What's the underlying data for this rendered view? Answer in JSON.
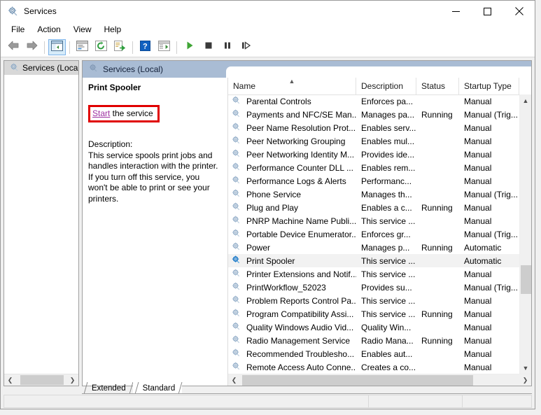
{
  "window": {
    "title": "Services",
    "icon": "services-gear-icon",
    "controls": {
      "minimize": "minimize-icon",
      "maximize": "maximize-icon",
      "close": "close-icon"
    }
  },
  "menubar": {
    "items": [
      {
        "label": "File",
        "name": "menu-file"
      },
      {
        "label": "Action",
        "name": "menu-action"
      },
      {
        "label": "View",
        "name": "menu-view"
      },
      {
        "label": "Help",
        "name": "menu-help"
      }
    ]
  },
  "toolbar": {
    "buttons": [
      {
        "name": "back-button",
        "icon": "back-arrow-icon"
      },
      {
        "name": "forward-button",
        "icon": "forward-arrow-icon"
      },
      {
        "name": "show-hide-tree-button",
        "icon": "show-tree-icon"
      },
      {
        "name": "properties-button",
        "icon": "properties-icon"
      },
      {
        "name": "refresh-button",
        "icon": "refresh-icon"
      },
      {
        "name": "export-list-button",
        "icon": "export-list-icon"
      },
      {
        "name": "help-button",
        "icon": "help-question-icon"
      },
      {
        "name": "show-action-pane-button",
        "icon": "action-pane-icon"
      },
      {
        "name": "start-service-button",
        "icon": "play-icon"
      },
      {
        "name": "stop-service-button",
        "icon": "stop-icon"
      },
      {
        "name": "pause-service-button",
        "icon": "pause-icon"
      },
      {
        "name": "restart-service-button",
        "icon": "restart-icon"
      }
    ]
  },
  "tree": {
    "root_label": "Services (Local",
    "root_icon": "services-gear-icon"
  },
  "content_header": {
    "label": "Services (Local)",
    "icon": "services-gear-icon"
  },
  "detail": {
    "service_name": "Print Spooler",
    "action_link": "Start",
    "action_suffix": " the service",
    "description_label": "Description:",
    "description_text": "This service spools print jobs and handles interaction with the printer. If you turn off this service, you won't be able to print or see your printers."
  },
  "list": {
    "columns": [
      {
        "label": "Name",
        "name": "column-header-name",
        "sort": "ascending"
      },
      {
        "label": "Description",
        "name": "column-header-description"
      },
      {
        "label": "Status",
        "name": "column-header-status"
      },
      {
        "label": "Startup Type",
        "name": "column-header-startup-type"
      }
    ],
    "rows": [
      {
        "name": "Parental Controls",
        "description": "Enforces pa...",
        "status": "",
        "startup": "Manual",
        "selected": false
      },
      {
        "name": "Payments and NFC/SE Man...",
        "description": "Manages pa...",
        "status": "Running",
        "startup": "Manual (Trig...",
        "selected": false
      },
      {
        "name": "Peer Name Resolution Prot...",
        "description": "Enables serv...",
        "status": "",
        "startup": "Manual",
        "selected": false
      },
      {
        "name": "Peer Networking Grouping",
        "description": "Enables mul...",
        "status": "",
        "startup": "Manual",
        "selected": false
      },
      {
        "name": "Peer Networking Identity M...",
        "description": "Provides ide...",
        "status": "",
        "startup": "Manual",
        "selected": false
      },
      {
        "name": "Performance Counter DLL ...",
        "description": "Enables rem...",
        "status": "",
        "startup": "Manual",
        "selected": false
      },
      {
        "name": "Performance Logs & Alerts",
        "description": "Performanc...",
        "status": "",
        "startup": "Manual",
        "selected": false
      },
      {
        "name": "Phone Service",
        "description": "Manages th...",
        "status": "",
        "startup": "Manual (Trig...",
        "selected": false
      },
      {
        "name": "Plug and Play",
        "description": "Enables a c...",
        "status": "Running",
        "startup": "Manual",
        "selected": false
      },
      {
        "name": "PNRP Machine Name Publi...",
        "description": "This service ...",
        "status": "",
        "startup": "Manual",
        "selected": false
      },
      {
        "name": "Portable Device Enumerator...",
        "description": "Enforces gr...",
        "status": "",
        "startup": "Manual (Trig...",
        "selected": false
      },
      {
        "name": "Power",
        "description": "Manages p...",
        "status": "Running",
        "startup": "Automatic",
        "selected": false
      },
      {
        "name": "Print Spooler",
        "description": "This service ...",
        "status": "",
        "startup": "Automatic",
        "selected": true
      },
      {
        "name": "Printer Extensions and Notif...",
        "description": "This service ...",
        "status": "",
        "startup": "Manual",
        "selected": false
      },
      {
        "name": "PrintWorkflow_52023",
        "description": "Provides su...",
        "status": "",
        "startup": "Manual (Trig...",
        "selected": false
      },
      {
        "name": "Problem Reports Control Pa...",
        "description": "This service ...",
        "status": "",
        "startup": "Manual",
        "selected": false
      },
      {
        "name": "Program Compatibility Assi...",
        "description": "This service ...",
        "status": "Running",
        "startup": "Manual",
        "selected": false
      },
      {
        "name": "Quality Windows Audio Vid...",
        "description": "Quality Win...",
        "status": "",
        "startup": "Manual",
        "selected": false
      },
      {
        "name": "Radio Management Service",
        "description": "Radio Mana...",
        "status": "Running",
        "startup": "Manual",
        "selected": false
      },
      {
        "name": "Recommended Troublesho...",
        "description": "Enables aut...",
        "status": "",
        "startup": "Manual",
        "selected": false
      },
      {
        "name": "Remote Access Auto Conne...",
        "description": "Creates a co...",
        "status": "",
        "startup": "Manual",
        "selected": false
      }
    ]
  },
  "tabs": [
    {
      "label": "Extended",
      "name": "tab-extended",
      "active": false
    },
    {
      "label": "Standard",
      "name": "tab-standard",
      "active": true
    }
  ],
  "colors": {
    "accent_header": "#a9bcd4",
    "annotation_red": "#e00000",
    "link_purple": "#9d2fa0",
    "selected_row": "#f2f2f2",
    "play_green": "#3fa535"
  }
}
